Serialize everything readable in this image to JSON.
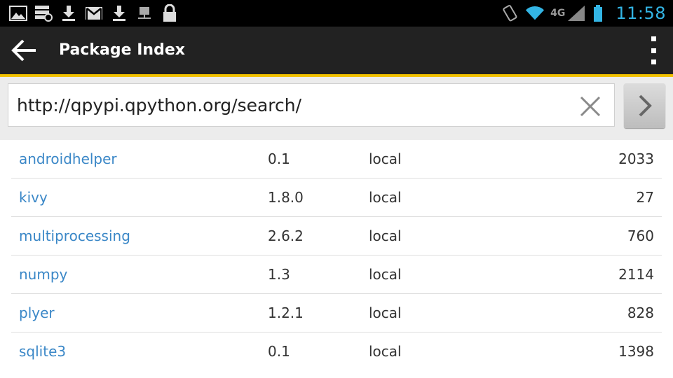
{
  "status_bar": {
    "time": "11:58",
    "network_type": "4G",
    "left_icons": [
      "image-icon",
      "sync-icon",
      "download-icon",
      "gmail-icon",
      "download-icon",
      "network-drive-icon",
      "lock-icon"
    ],
    "right_icons": [
      "vibrate-icon",
      "wifi-icon",
      "signal-icon",
      "battery-icon"
    ],
    "clock_color": "#33b5e5"
  },
  "action_bar": {
    "title": "Package Index",
    "accent_color": "#f2c200"
  },
  "url_bar": {
    "value": "http://qpypi.qpython.org/search/"
  },
  "packages": [
    {
      "name": "androidhelper",
      "version": "0.1",
      "source": "local",
      "count": "2033"
    },
    {
      "name": "kivy",
      "version": "1.8.0",
      "source": "local",
      "count": "27"
    },
    {
      "name": "multiprocessing",
      "version": "2.6.2",
      "source": "local",
      "count": "760"
    },
    {
      "name": "numpy",
      "version": "1.3",
      "source": "local",
      "count": "2114"
    },
    {
      "name": "plyer",
      "version": "1.2.1",
      "source": "local",
      "count": "828"
    },
    {
      "name": "sqlite3",
      "version": "0.1",
      "source": "local",
      "count": "1398"
    }
  ],
  "colors": {
    "link": "#3a87c7",
    "action_bar": "#222222"
  }
}
